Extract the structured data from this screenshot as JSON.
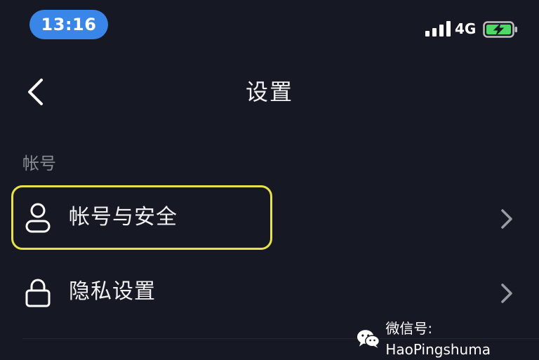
{
  "status_bar": {
    "time": "13:16",
    "network": "4G",
    "signal_icon": "signal-bars-icon",
    "battery_icon": "battery-charging-icon"
  },
  "nav": {
    "back_icon": "chevron-left-icon",
    "title": "设置"
  },
  "section": {
    "header": "帐号"
  },
  "items": [
    {
      "label": "帐号与安全",
      "icon": "user-icon",
      "highlighted": true
    },
    {
      "label": "隐私设置",
      "icon": "lock-icon",
      "highlighted": false
    }
  ],
  "watermark": {
    "icon": "wechat-icon",
    "text": "微信号: HaoPingshuma"
  },
  "colors": {
    "background": "#161823",
    "time_pill": "#3a86e8",
    "highlight_border": "#e8e24a",
    "battery_fill": "#4cd964",
    "secondary_text": "#8a8c94"
  }
}
